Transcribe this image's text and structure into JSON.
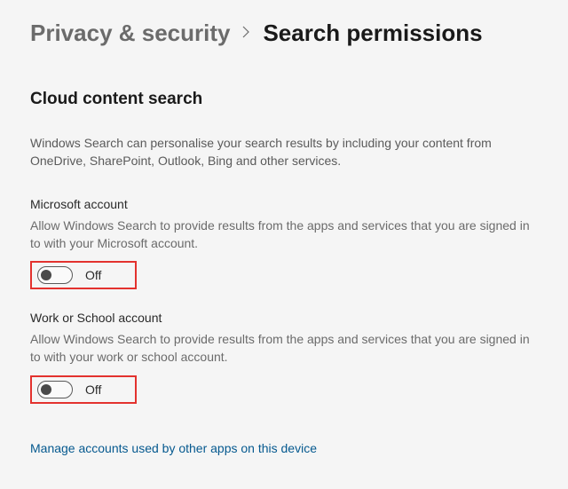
{
  "breadcrumb": {
    "parent": "Privacy & security",
    "current": "Search permissions"
  },
  "section": {
    "title": "Cloud content search",
    "description": "Windows Search can personalise your search results by including your content from OneDrive, SharePoint, Outlook, Bing and other services."
  },
  "settings": [
    {
      "title": "Microsoft account",
      "description": "Allow Windows Search to provide results from the apps and services that you are signed in to with your Microsoft account.",
      "state_label": "Off",
      "highlighted": true
    },
    {
      "title": "Work or School account",
      "description": "Allow Windows Search to provide results from the apps and services that you are signed in to with your work or school account.",
      "state_label": "Off",
      "highlighted": true
    }
  ],
  "link": "Manage accounts used by other apps on this device"
}
